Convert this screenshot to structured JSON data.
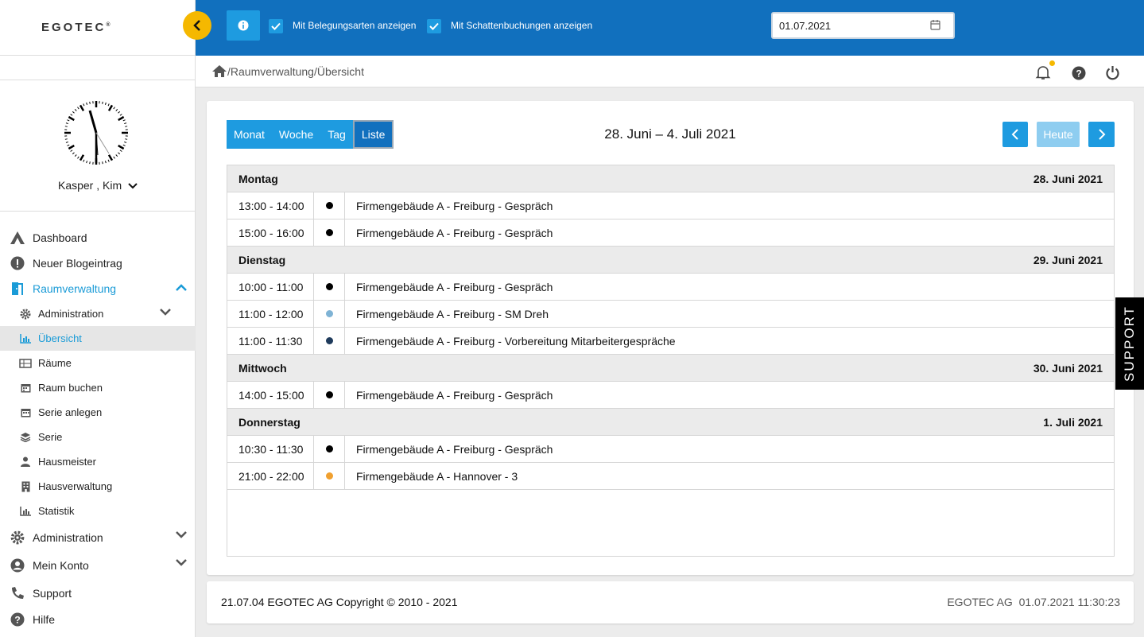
{
  "brand": {
    "logo_text": "EGOTEC",
    "logo_mark": "®"
  },
  "topbar": {
    "checkbox1_label": "Mit Belegungsarten anzeigen",
    "checkbox2_label": "Mit Schattenbuchungen anzeigen",
    "date_value": "01.07.2021",
    "checkbox1_checked": true,
    "checkbox2_checked": true
  },
  "breadcrumb": {
    "path": "/Raumverwaltung/Übersicht"
  },
  "user": {
    "name": "Kasper , Kim"
  },
  "clock": {
    "time_shown": "11:30:23"
  },
  "nav": {
    "dashboard": "Dashboard",
    "blog": "Neuer Blogeintrag",
    "raumverwaltung": "Raumverwaltung",
    "sub": {
      "administration": "Administration",
      "uebersicht": "Übersicht",
      "raeume": "Räume",
      "raum_buchen": "Raum buchen",
      "serie_anlegen": "Serie anlegen",
      "serie": "Serie",
      "hausmeister": "Hausmeister",
      "hausverwaltung": "Hausverwaltung",
      "statistik": "Statistik"
    },
    "administration": "Administration",
    "mein_konto": "Mein Konto",
    "support": "Support",
    "hilfe": "Hilfe"
  },
  "calendar": {
    "views": [
      "Monat",
      "Woche",
      "Tag",
      "Liste"
    ],
    "active_view": "Liste",
    "title": "28. Juni – 4. Juli 2021",
    "today_label": "Heute",
    "days": [
      {
        "name": "Montag",
        "date": "28. Juni 2021",
        "events": [
          {
            "time": "13:00 - 14:00",
            "color": "#000000",
            "title": "Firmengebäude A - Freiburg - Gespräch"
          },
          {
            "time": "15:00 - 16:00",
            "color": "#000000",
            "title": "Firmengebäude A - Freiburg - Gespräch"
          }
        ]
      },
      {
        "name": "Dienstag",
        "date": "29. Juni 2021",
        "events": [
          {
            "time": "10:00 - 11:00",
            "color": "#000000",
            "title": "Firmengebäude A - Freiburg - Gespräch"
          },
          {
            "time": "11:00 - 12:00",
            "color": "#7fb3d5",
            "title": "Firmengebäude A - Freiburg - SM Dreh"
          },
          {
            "time": "11:00 - 11:30",
            "color": "#1f3b5c",
            "title": "Firmengebäude A - Freiburg - Vorbereitung Mitarbeitergespräche"
          }
        ]
      },
      {
        "name": "Mittwoch",
        "date": "30. Juni 2021",
        "events": [
          {
            "time": "14:00 - 15:00",
            "color": "#000000",
            "title": "Firmengebäude A - Freiburg - Gespräch"
          }
        ]
      },
      {
        "name": "Donnerstag",
        "date": "1. Juli 2021",
        "events": [
          {
            "time": "10:30 - 11:30",
            "color": "#000000",
            "title": "Firmengebäude A - Freiburg - Gespräch"
          },
          {
            "time": "21:00 - 22:00",
            "color": "#f0a030",
            "title": "Firmengebäude A - Hannover - 3"
          }
        ]
      }
    ]
  },
  "footer": {
    "left": "21.07.04 EGOTEC AG Copyright © 2010 - 2021",
    "right": "EGOTEC AG  01.07.2021 11:30:23"
  },
  "support_tab": "SUPPORT",
  "colors": {
    "primary": "#1170be",
    "accent": "#1e9be0",
    "highlight": "#f5b800"
  }
}
